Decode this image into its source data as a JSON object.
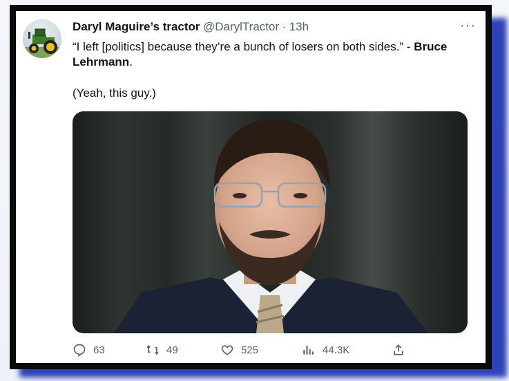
{
  "tweet": {
    "display_name": "Daryl Maguire’s tractor",
    "handle": "@DarylTractor",
    "separator": "·",
    "time": "13h",
    "more_label": "···",
    "quote_prefix": "“I left [politics] because they’re a bunch of losers on both sides.” - ",
    "quote_author": "Bruce Lehrmann",
    "quote_suffix": ".",
    "paragraph2": "(Yeah, this guy.)"
  },
  "actions": {
    "replies": "63",
    "retweets": "49",
    "likes": "525",
    "views": "44.3K"
  },
  "colors": {
    "frame": "#0a0a0a",
    "shadow": "#2e43b8",
    "text": "#0f1419",
    "muted": "#536471"
  },
  "icons": {
    "avatar": "tractor-avatar-icon",
    "reply": "reply-icon",
    "retweet": "retweet-icon",
    "like": "heart-icon",
    "views": "views-icon",
    "share": "share-icon",
    "more": "more-icon"
  }
}
